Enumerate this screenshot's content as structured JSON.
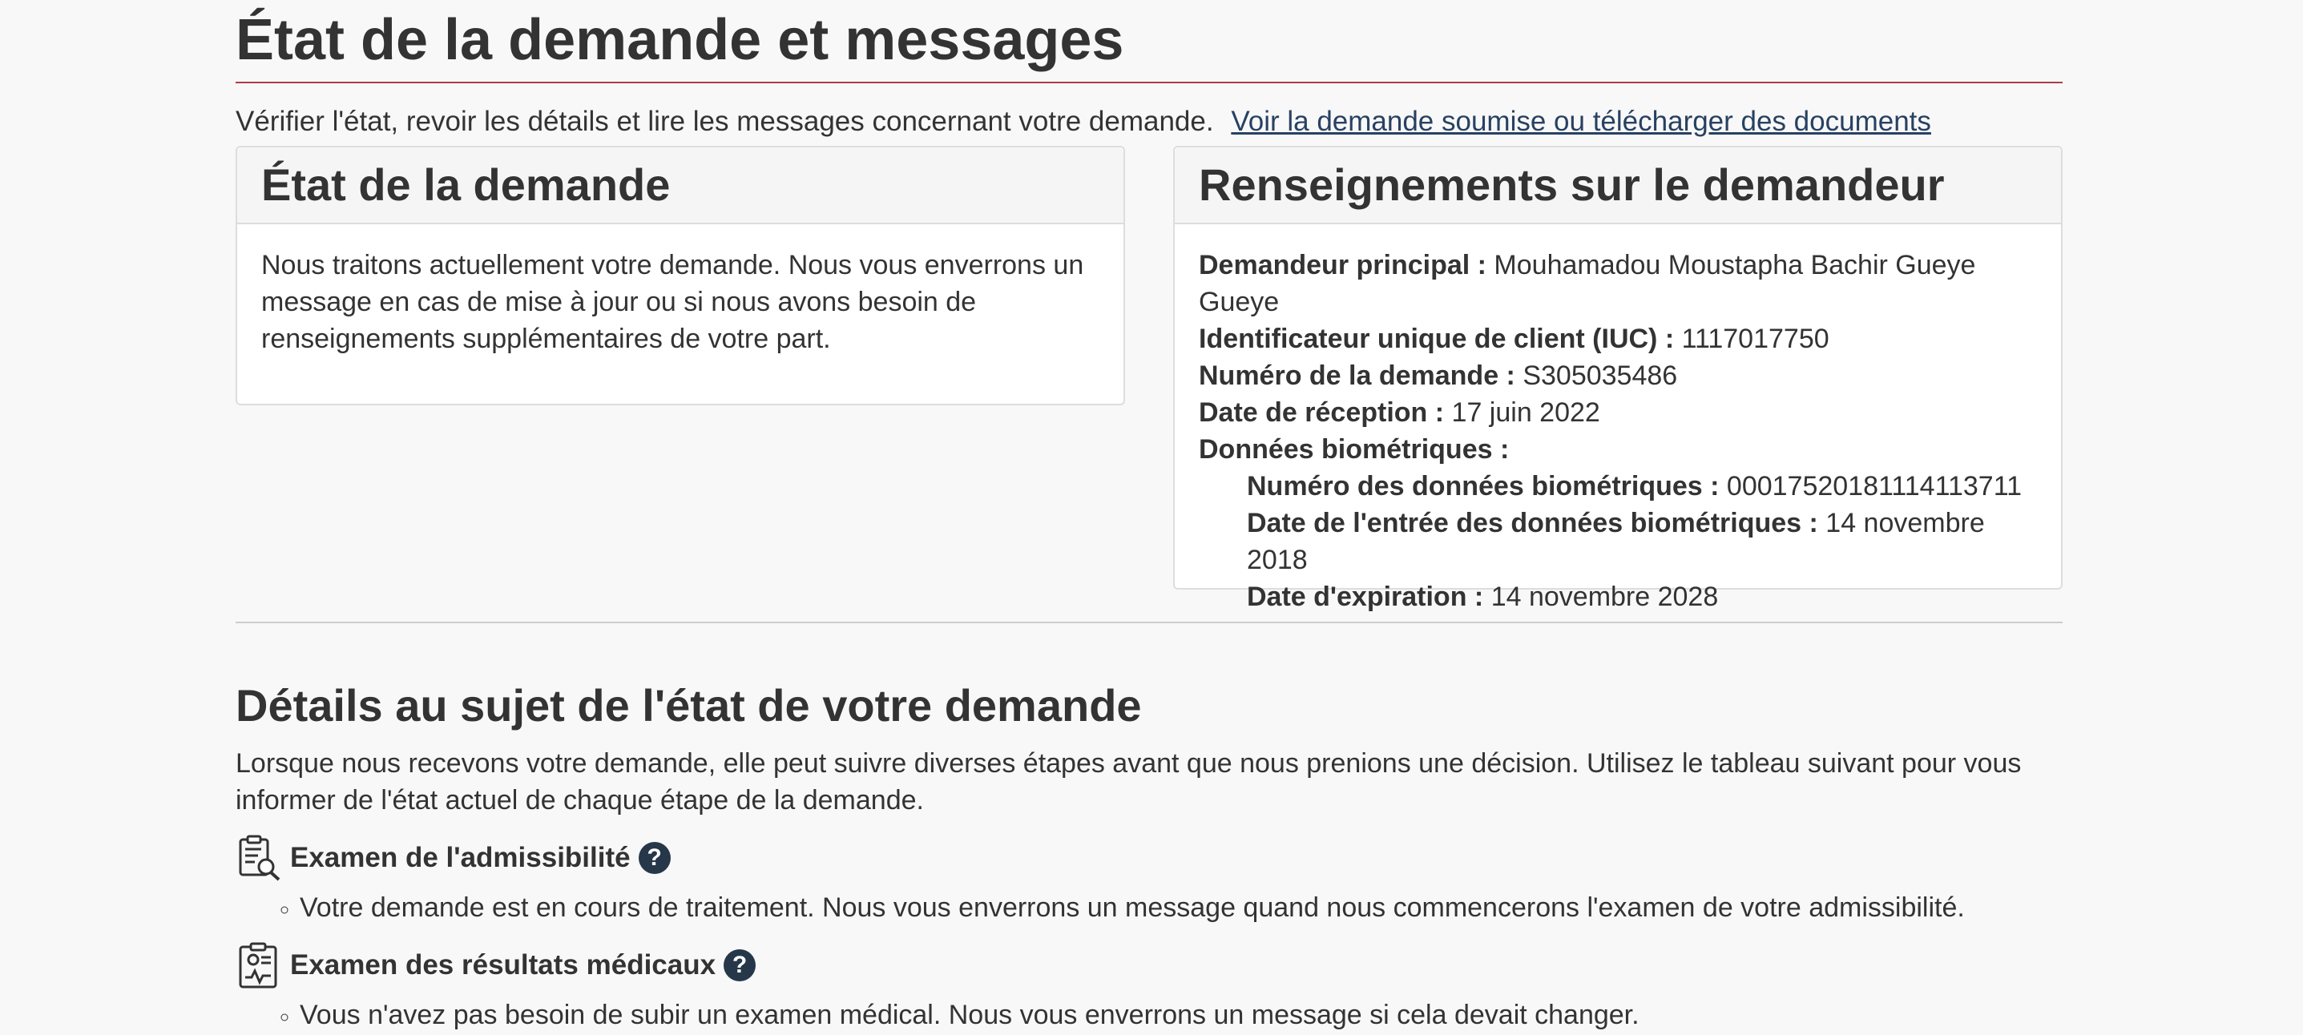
{
  "page": {
    "title": "État de la demande et messages",
    "intro": "Vérifier l'état, revoir les détails et lire les messages concernant votre demande.",
    "intro_link": "Voir la demande soumise ou télécharger des documents"
  },
  "status_panel": {
    "title": "État de la demande",
    "text": "Nous traitons actuellement votre demande. Nous vous enverrons un message en cas de mise à jour ou si nous avons besoin de renseignements supplémentaires de votre part."
  },
  "applicant_panel": {
    "title": "Renseignements sur le demandeur",
    "principal_label": "Demandeur principal :",
    "principal_value": "Mouhamadou Moustapha Bachir Gueye Gueye",
    "uci_label": "Identificateur unique de client (IUC) :",
    "uci_value": "1117017750",
    "app_number_label": "Numéro de la demande :",
    "app_number_value": "S305035486",
    "received_label": "Date de réception :",
    "received_value": "17 juin 2022",
    "biometrics_label": "Données biométriques :",
    "bio_number_label": "Numéro des données biométriques :",
    "bio_number_value": "00017520181114113711",
    "bio_date_label": "Date de l'entrée des données biométriques :",
    "bio_date_value": "14 novembre 2018",
    "expiry_label": "Date d'expiration :",
    "expiry_value": "14 novembre 2028"
  },
  "details": {
    "title": "Détails au sujet de l'état de votre demande",
    "text": "Lorsque nous recevons votre demande, elle peut suivre diverses étapes avant que nous prenions une décision. Utilisez le tableau suivant pour vous informer de l'état actuel de chaque étape de la demande.",
    "steps": [
      {
        "icon": "clipboard-search-icon",
        "title": "Examen de l'admissibilité",
        "status": "Votre demande est en cours de traitement. Nous vous enverrons un message quand nous commencerons l'examen de votre admissibilité."
      },
      {
        "icon": "medical-report-icon",
        "title": "Examen des résultats médicaux",
        "status": "Vous n'avez pas besoin de subir un examen médical. Nous vous enverrons un message si cela devait changer."
      }
    ],
    "help_glyph": "?"
  },
  "colors": {
    "accent_rule": "#af3c43",
    "link": "#284162",
    "help_icon": "#26374a"
  }
}
